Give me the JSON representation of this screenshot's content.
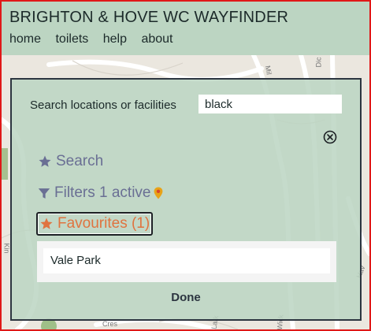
{
  "header": {
    "title": "BRIGHTON & HOVE WC WAYFINDER",
    "nav": [
      "home",
      "toilets",
      "help",
      "about"
    ]
  },
  "map": {
    "street_labels": [
      "Mil",
      "Dic",
      "Kin",
      "Cres",
      "Lark",
      "Wick",
      "Hav"
    ]
  },
  "panel": {
    "search_label": "Search locations or facilities",
    "search_value": "black",
    "menu": {
      "search_label": "Search",
      "filters_label": "Filters 1 active",
      "favourites_label": "Favourites (1)"
    },
    "favourites": [
      "Vale Park"
    ],
    "done_label": "Done"
  },
  "colors": {
    "header_bg": "#bcd5c2",
    "menu_text": "#6a6f94",
    "favourites_accent": "#e0733f",
    "marker": "#e8a317",
    "frame_border": "#e01818"
  },
  "icons": {
    "close": "close-circle-icon",
    "search": "star-icon",
    "filters": "funnel-icon",
    "filter_marker": "map-marker-icon",
    "favourites": "star-icon"
  }
}
